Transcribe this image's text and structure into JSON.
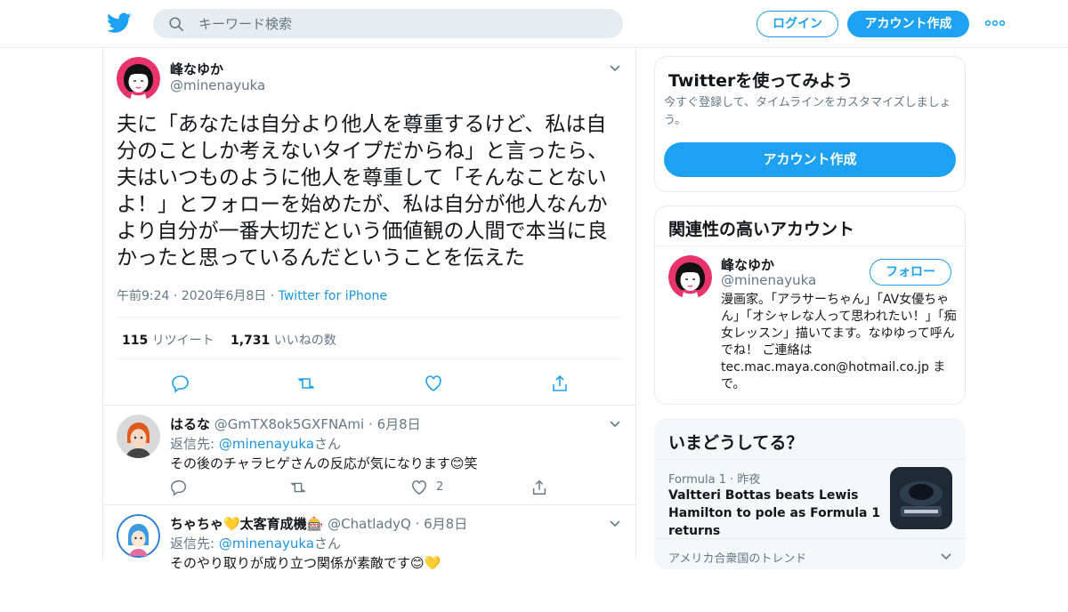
{
  "header": {
    "search_placeholder": "キーワード検索",
    "login_label": "ログイン",
    "signup_label": "アカウント作成"
  },
  "tweet": {
    "name": "峰なゆか",
    "handle": "@minenayuka",
    "text": "夫に「あなたは自分より他人を尊重するけど、私は自分のことしか考えないタイプだからね」と言ったら、夫はいつものように他人を尊重して「そんなことないよ！」とフォローを始めたが、私は自分が他人なんかより自分が一番大切だという価値観の人間で本当に良かったと思っているんだということを伝えた",
    "time": "午前9:24",
    "date": "2020年6月8日",
    "source": "Twitter for iPhone",
    "retweet_count": "115",
    "retweet_label": "リツイート",
    "like_count": "1,731",
    "like_label": "いいねの数"
  },
  "replies": [
    {
      "name": "はるな",
      "handle": "@GmTX8ok5GXFNAmi",
      "date": "6月8日",
      "reply_to_prefix": "返信先: ",
      "reply_to_mention": "@minenayuka",
      "reply_to_suffix": "さん",
      "text": "その後のチャラヒゲさんの反応が気になります😊笑",
      "like_count": "2"
    },
    {
      "name": "ちゃちゃ💛太客育成機🎰",
      "handle": "@ChatladyQ",
      "date": "6月8日",
      "reply_to_prefix": "返信先: ",
      "reply_to_mention": "@minenayuka",
      "reply_to_suffix": "さん",
      "text": "そのやり取りが成り立つ関係が素敵です😊💛"
    }
  ],
  "sidebar": {
    "try_card": {
      "title": "Twitterを使ってみよう",
      "desc": "今すぐ登録して、タイムラインをカスタマイズしましょう。",
      "button": "アカウント作成"
    },
    "related": {
      "title": "関連性の高いアカウント",
      "name": "峰なゆか",
      "handle": "@minenayuka",
      "follow_label": "フォロー",
      "bio": "漫画家。「アラサーちゃん」「AV女優ちゃん」「オシャレな人って思われたい！」「痴女レッスン」描いてます。なゆゆって呼んでね！ ご連絡は tec.mac.maya.con@hotmail.co.jp まで。"
    },
    "trends": {
      "title": "いまどうしてる？",
      "item_category": "Formula 1",
      "item_time": "昨夜",
      "item_title": "Valtteri Bottas beats Lewis Hamilton to pole as Formula 1 returns",
      "next_label": "アメリカ合衆国のトレンド"
    }
  },
  "colors": {
    "accent": "#1da1f2",
    "link": "#1b95e0",
    "muted": "#657786",
    "border": "#e6ecf0"
  }
}
